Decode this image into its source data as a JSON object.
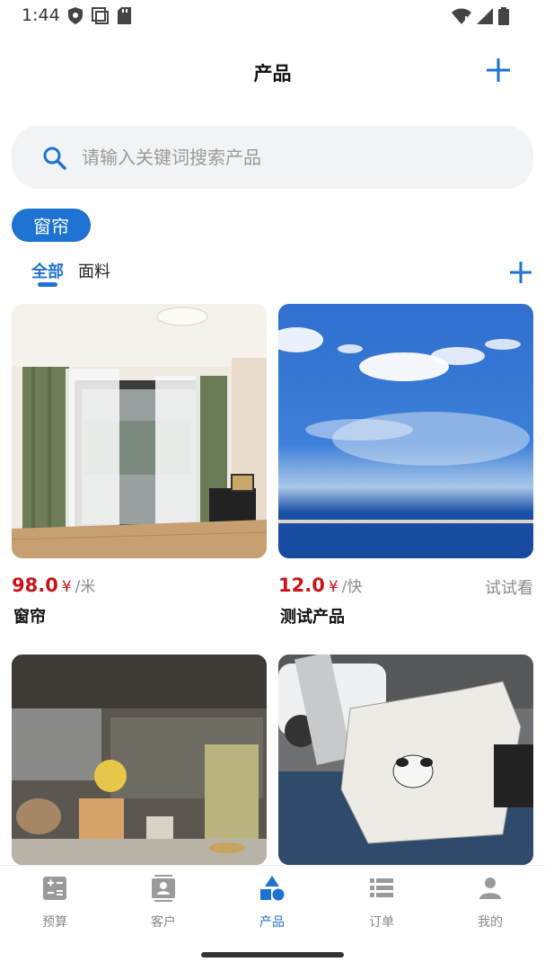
{
  "status": {
    "time": "1:44",
    "icons": [
      "shield-status-icon",
      "screenshot-status-icon",
      "sd-card-icon",
      "wifi-icon",
      "signal-icon",
      "battery-icon"
    ]
  },
  "header": {
    "title": "产品",
    "add_icon": "plus-icon"
  },
  "search": {
    "placeholder": "请输入关键词搜索产品",
    "icon": "search-icon"
  },
  "category": {
    "label": "窗帘"
  },
  "subtabs": {
    "items": [
      {
        "label": "全部",
        "active": true
      },
      {
        "label": "面料",
        "active": false
      }
    ],
    "add_icon": "plus-icon"
  },
  "products": [
    {
      "price": "98.0",
      "currency": "¥",
      "unit": "/米",
      "name": "窗帘",
      "note": "",
      "image": "curtain-room-photo"
    },
    {
      "price": "12.0",
      "currency": "¥",
      "unit": "/快",
      "name": "测试产品",
      "note": "试试看",
      "image": "sky-clouds-photo"
    },
    {
      "image": "shelf-figurines-photo"
    },
    {
      "image": "scooter-cover-photo"
    }
  ],
  "bottom_nav": {
    "items": [
      {
        "label": "预算",
        "icon": "calculator-icon",
        "active": false
      },
      {
        "label": "客户",
        "icon": "contact-card-icon",
        "active": false
      },
      {
        "label": "产品",
        "icon": "shapes-icon",
        "active": true
      },
      {
        "label": "订单",
        "icon": "list-icon",
        "active": false
      },
      {
        "label": "我的",
        "icon": "person-icon",
        "active": false
      }
    ]
  },
  "colors": {
    "accent": "#1d72d2",
    "price": "#c8141b",
    "muted": "#8a8a8a"
  }
}
